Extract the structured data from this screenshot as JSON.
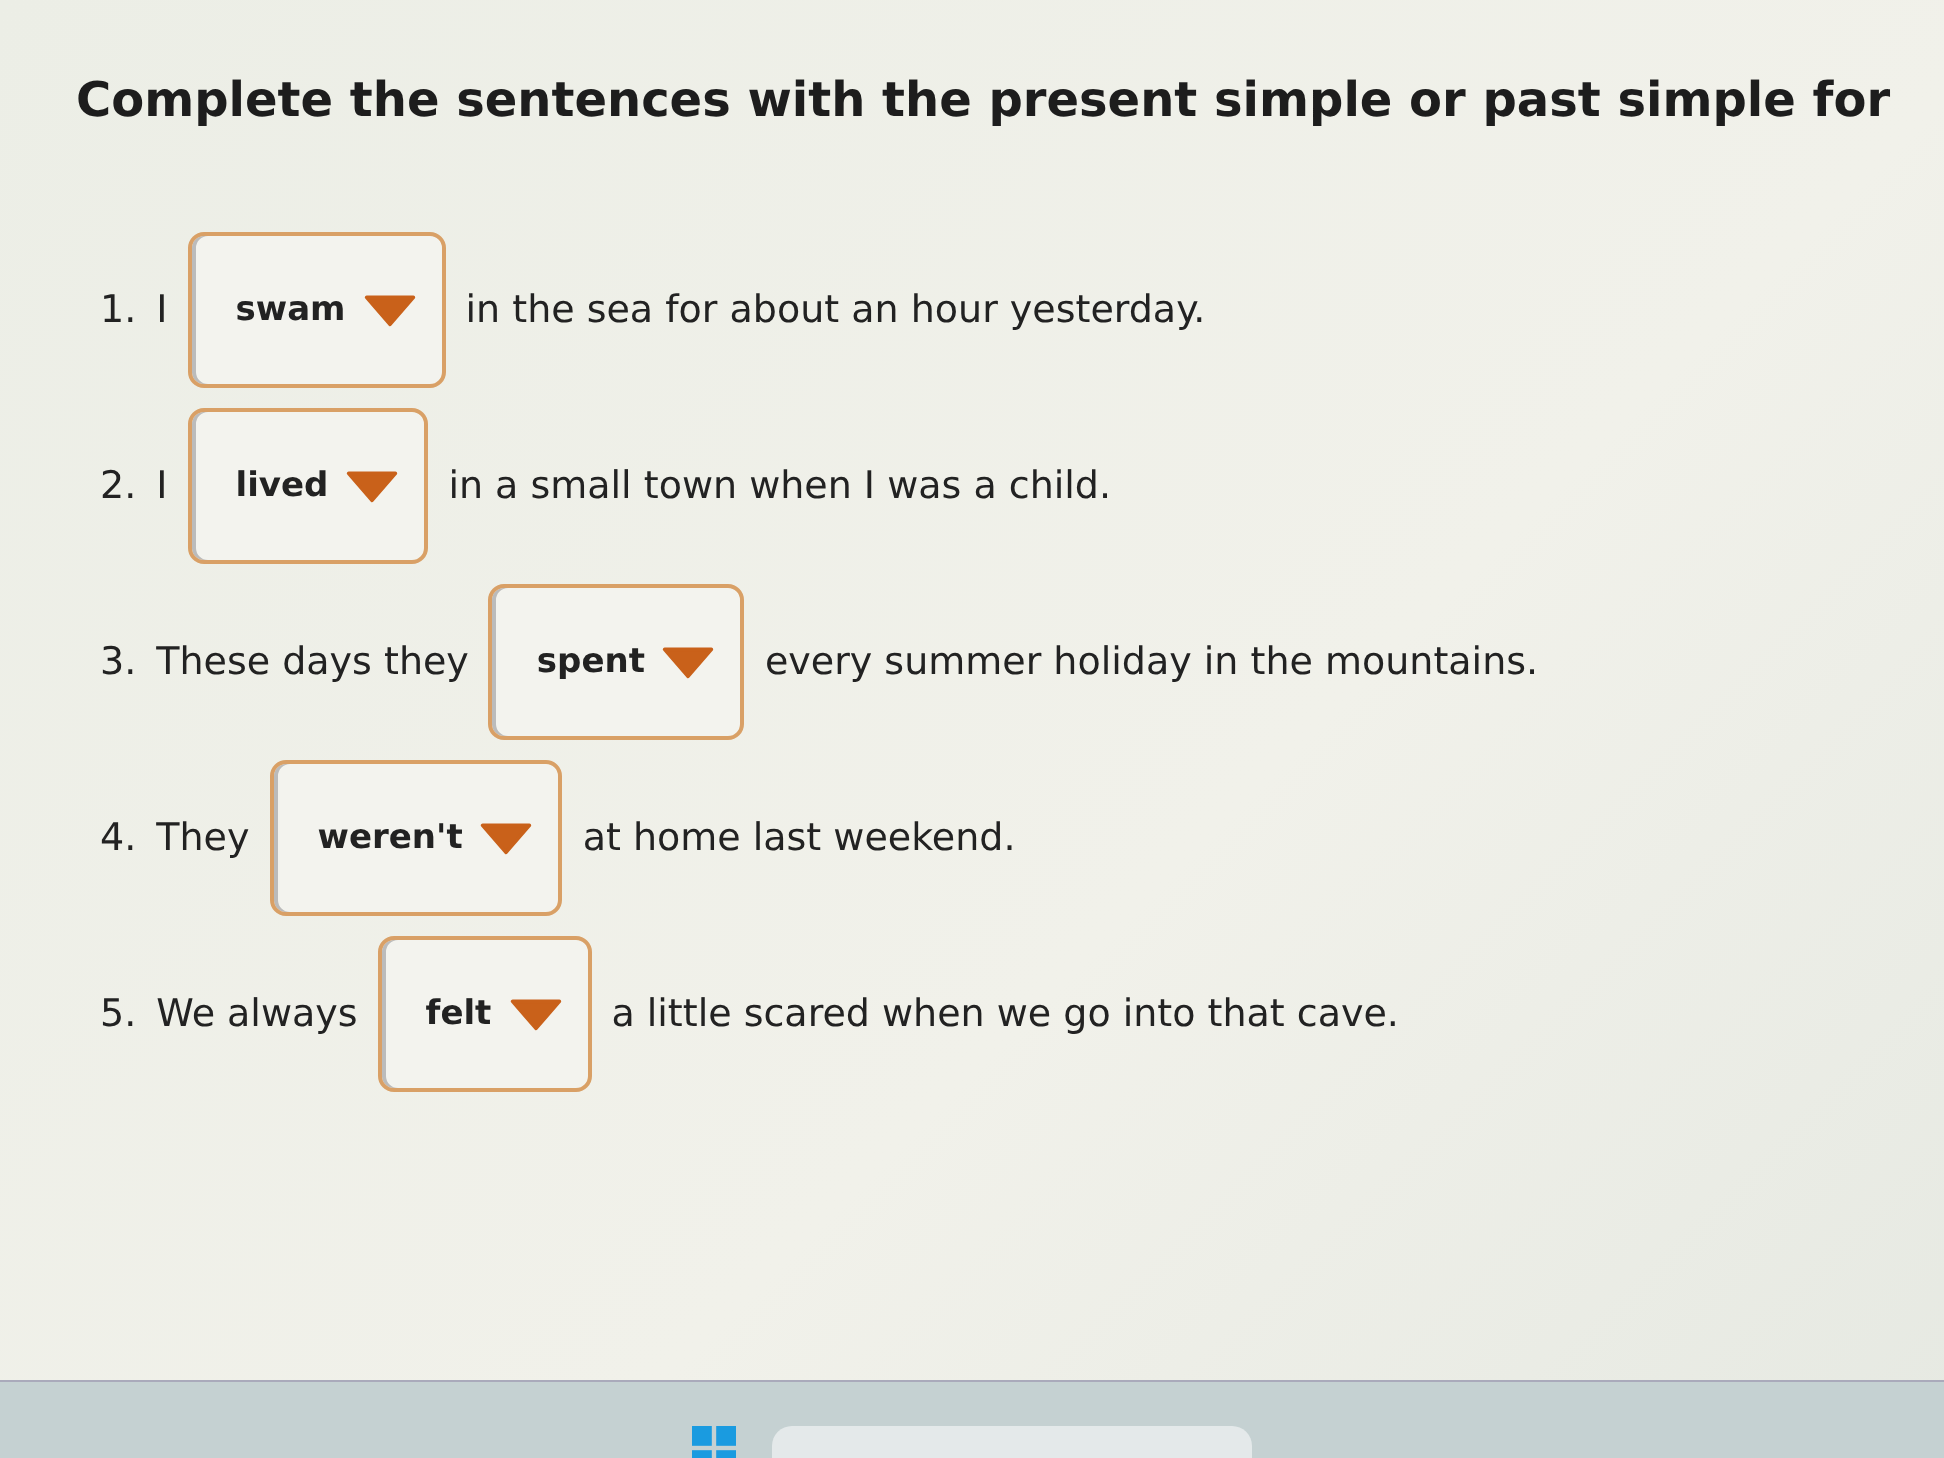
{
  "title": "Complete the sentences with the present simple or past simple for",
  "items": [
    {
      "number": "1.",
      "before": "I",
      "answer": "swam",
      "after": "in the sea for about an hour yesterday."
    },
    {
      "number": "2.",
      "before": "I",
      "answer": "lived",
      "after": "in a small town when I was a child."
    },
    {
      "number": "3.",
      "before": "These days they",
      "answer": "spent",
      "after": "every summer holiday in the mountains."
    },
    {
      "number": "4.",
      "before": "They",
      "answer": "weren't",
      "after": "at home last weekend."
    },
    {
      "number": "5.",
      "before": "We always",
      "answer": "felt",
      "after": "a little scared when we go into that cave."
    }
  ]
}
